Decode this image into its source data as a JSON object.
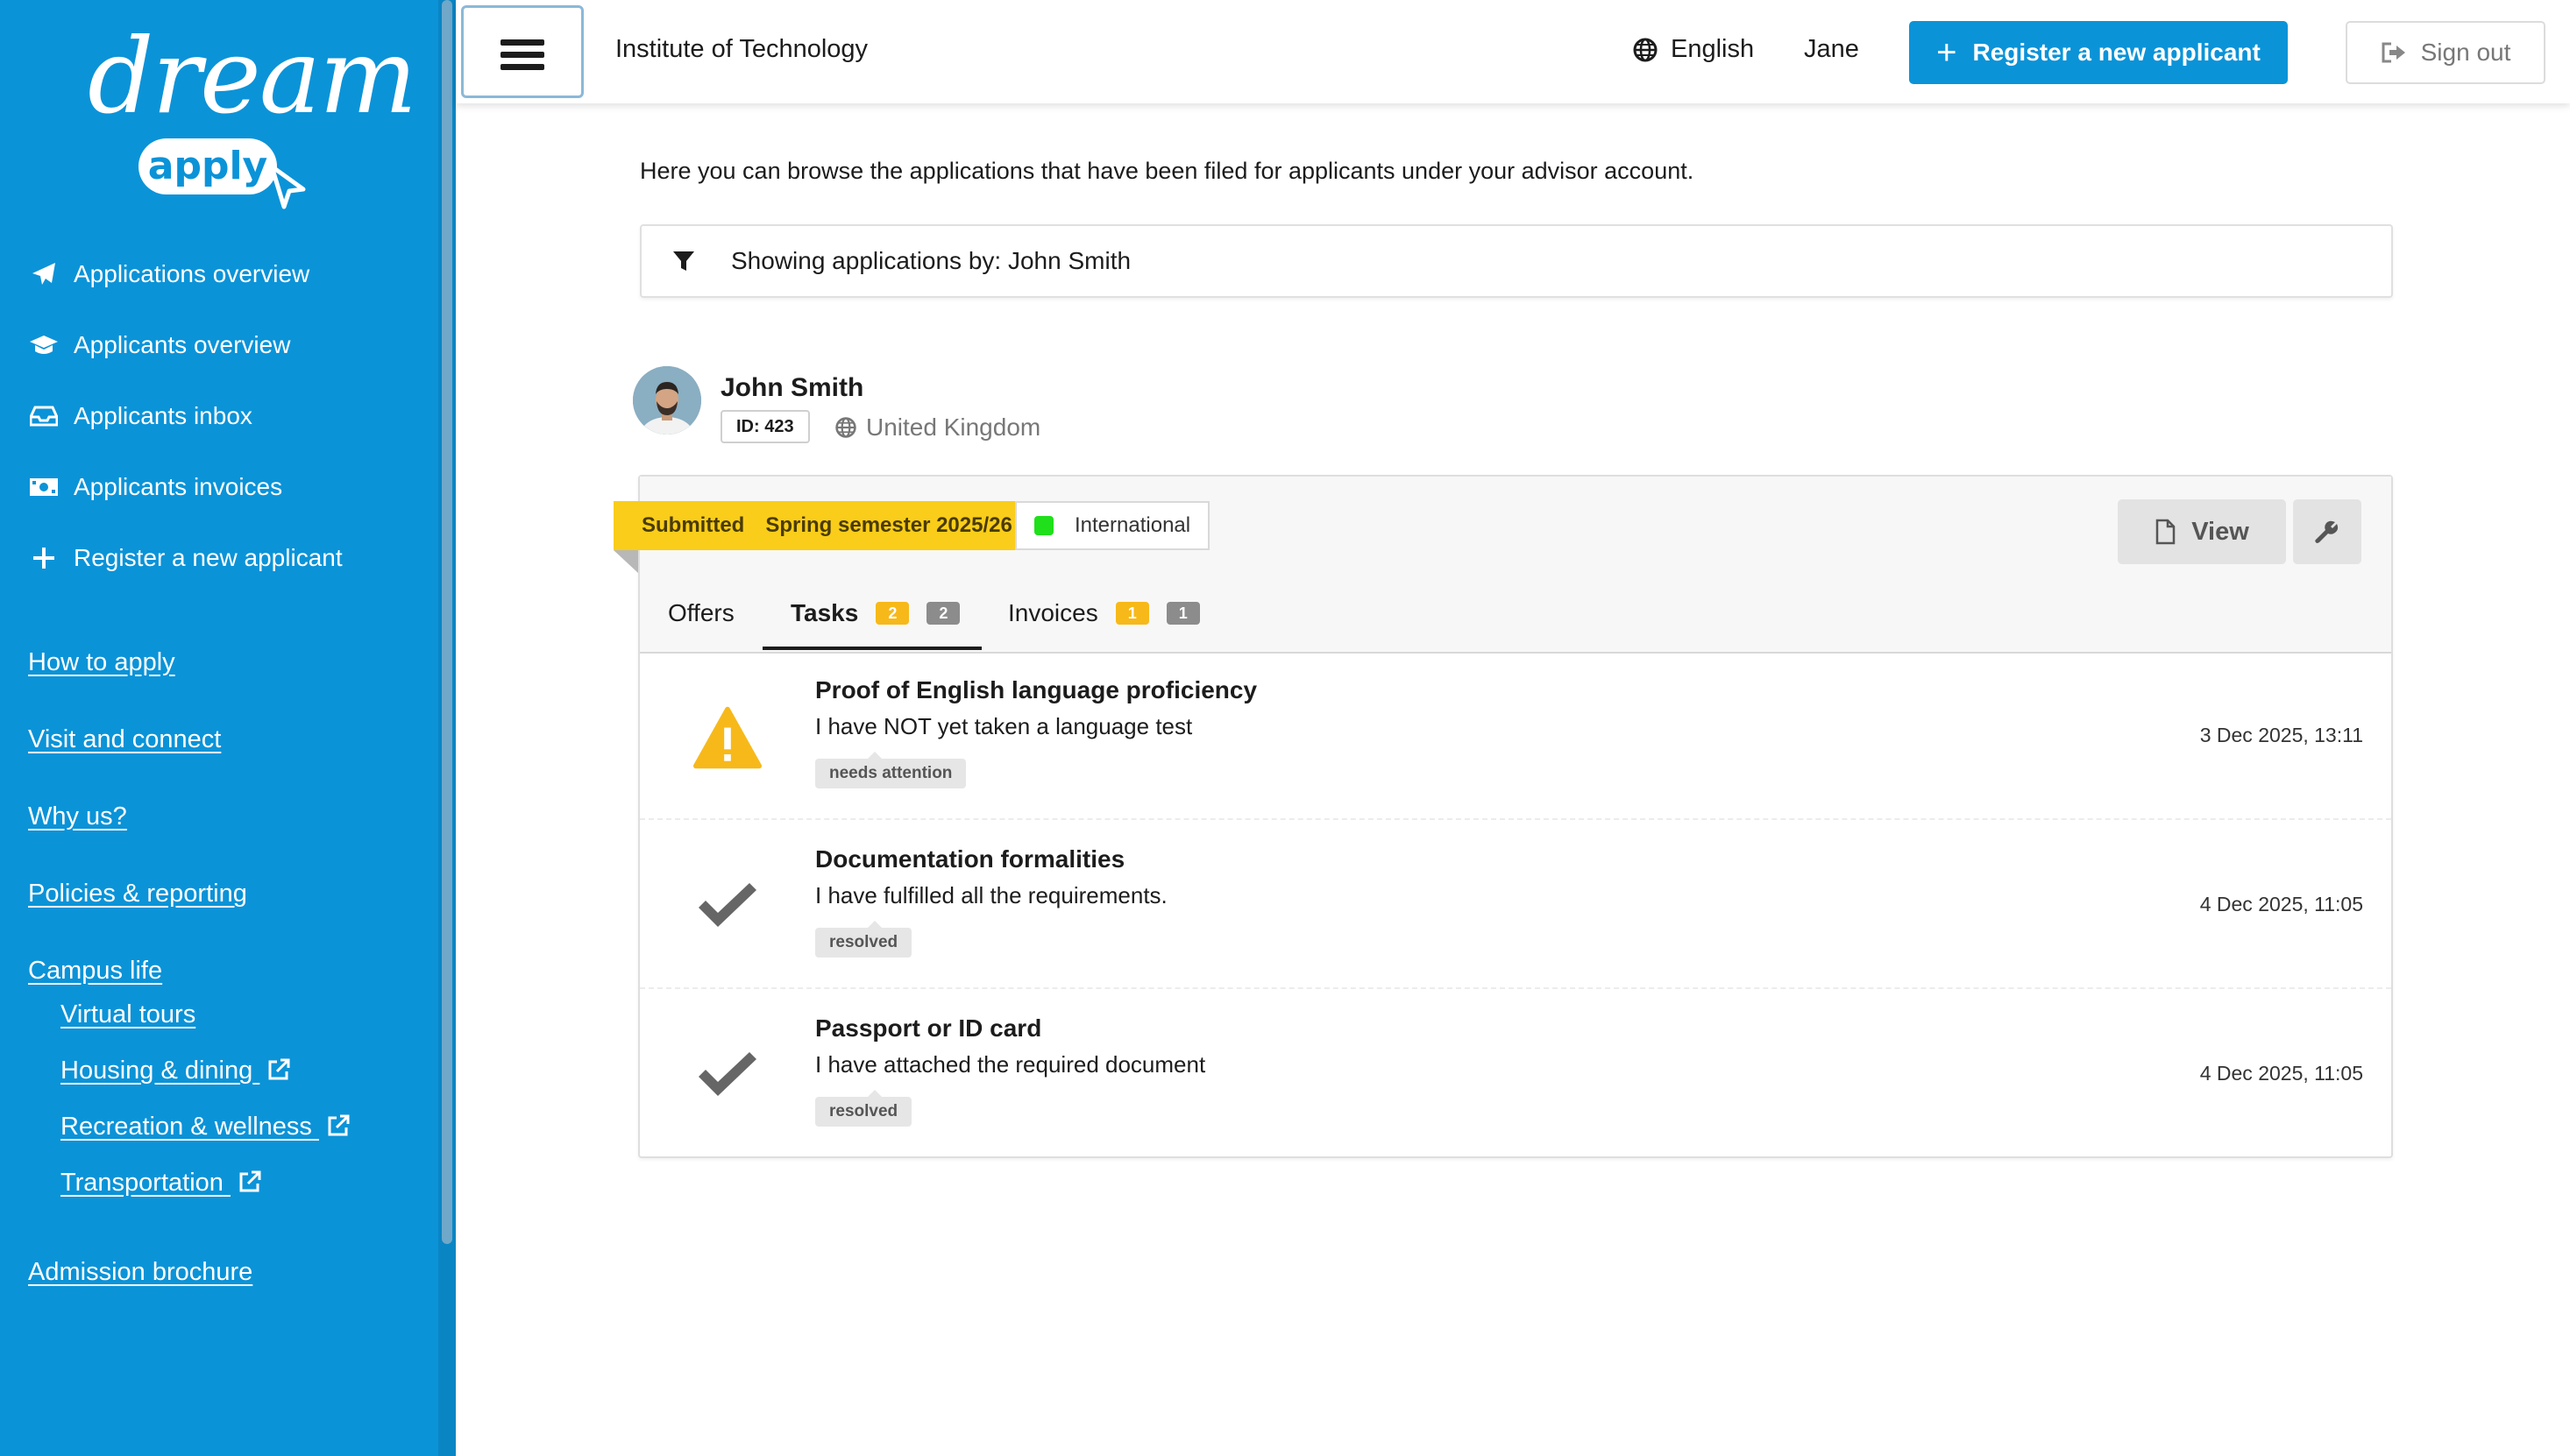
{
  "brand": {
    "logo_word": "dream",
    "logo_pill": "apply"
  },
  "sidebar": {
    "nav": [
      {
        "label": "Applications overview",
        "icon": "paper-plane-icon"
      },
      {
        "label": "Applicants overview",
        "icon": "graduation-cap-icon"
      },
      {
        "label": "Applicants inbox",
        "icon": "inbox-icon"
      },
      {
        "label": "Applicants invoices",
        "icon": "money-bill-icon"
      },
      {
        "label": "Register a new applicant",
        "icon": "plus-icon"
      }
    ],
    "links": [
      {
        "label": "How to apply"
      },
      {
        "label": "Visit and connect"
      },
      {
        "label": "Why us?"
      },
      {
        "label": "Policies & reporting"
      },
      {
        "label": "Campus life"
      },
      {
        "label": "Virtual tours"
      },
      {
        "label": "Housing & dining"
      },
      {
        "label": "Recreation & wellness"
      },
      {
        "label": "Transportation"
      },
      {
        "label": "Admission brochure"
      }
    ]
  },
  "header": {
    "institute": "Institute of Technology",
    "language": "English",
    "user": "Jane",
    "register_button": "Register a new applicant",
    "signout_button": "Sign out"
  },
  "main": {
    "intro": "Here you can browse the applications that have been filed for applicants under your advisor account.",
    "filter": "Showing applications by: John Smith"
  },
  "applicant": {
    "name": "John Smith",
    "id_badge": "ID: 423",
    "country": "United Kingdom"
  },
  "application": {
    "status": "Submitted",
    "intake": "Spring semester 2025/26",
    "type": "International",
    "view_button": "View",
    "tabs": [
      {
        "label": "Offers"
      },
      {
        "label": "Tasks",
        "count_attention": "2",
        "count_total": "2"
      },
      {
        "label": "Invoices",
        "count_attention": "1",
        "count_total": "1"
      }
    ],
    "tasks": [
      {
        "title": "Proof of English language proficiency",
        "description": "I have NOT yet taken a language test",
        "state": "needs attention",
        "date": "3 Dec 2025, 13:11",
        "icon": "warning-icon"
      },
      {
        "title": "Documentation formalities",
        "description": "I have fulfilled all the requirements.",
        "state": "resolved",
        "date": "4 Dec 2025, 11:05",
        "icon": "check-icon"
      },
      {
        "title": "Passport or ID card",
        "description": "I have attached the required document",
        "state": "resolved",
        "date": "4 Dec 2025, 11:05",
        "icon": "check-icon"
      }
    ]
  },
  "colors": {
    "brand_blue": "#0b93d8",
    "status_yellow": "#f9cd1a",
    "international_green": "#1fe01a",
    "warning_yellow": "#f7b91a"
  }
}
